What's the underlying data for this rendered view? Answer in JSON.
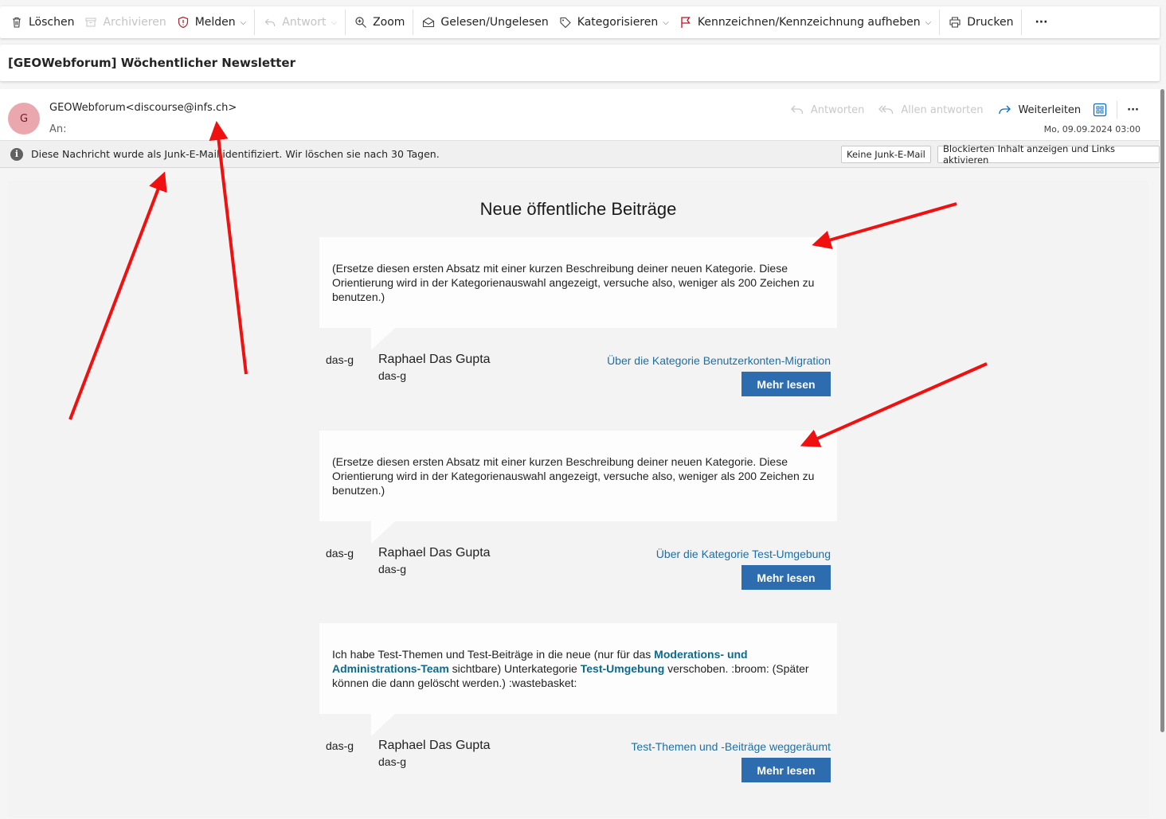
{
  "toolbar": {
    "delete": "Löschen",
    "archive": "Archivieren",
    "report": "Melden",
    "reply": "Antwort",
    "zoom": "Zoom",
    "read_unread": "Gelesen/Ungelesen",
    "categorize": "Kategorisieren",
    "flag": "Kennzeichnen/Kennzeichnung aufheben",
    "print": "Drucken",
    "more": "···"
  },
  "subject": "[GEOWebforum] Wöchentlicher Newsletter",
  "message": {
    "avatar_initial": "G",
    "sender": "GEOWebforum<discourse@infs.ch>",
    "to_label": "An:",
    "actions": {
      "reply": "Antworten",
      "reply_all": "Allen antworten",
      "forward": "Weiterleiten",
      "more": "···"
    },
    "date": "Mo, 09.09.2024 03:00"
  },
  "junk": {
    "notice": "Diese Nachricht wurde als Junk-E-Mail identifiziert. Wir löschen sie nach 30 Tagen.",
    "not_junk_button": "Keine Junk-E-Mail",
    "show_content_button": "Blockierten Inhalt anzeigen und Links aktivieren"
  },
  "newsletter": {
    "title": "Neue öffentliche Beiträge",
    "posts": [
      {
        "text": "(Ersetze diesen ersten Absatz mit einer kurzen Beschreibung deiner neuen Kategorie. Diese Orientierung wird in der Kategorienauswahl angezeigt, versuche also, weniger als 200 Zeichen zu benutzen.)",
        "user_short": "das-g",
        "user_full": "Raphael Das Gupta",
        "user_handle": "das-g",
        "topic": "Über die Kategorie Benutzerkonten-Migration",
        "button": "Mehr lesen"
      },
      {
        "text": "(Ersetze diesen ersten Absatz mit einer kurzen Beschreibung deiner neuen Kategorie. Diese Orientierung wird in der Kategorienauswahl angezeigt, versuche also, weniger als 200 Zeichen zu benutzen.)",
        "user_short": "das-g",
        "user_full": "Raphael Das Gupta",
        "user_handle": "das-g",
        "topic": "Über die Kategorie Test-Umgebung",
        "button": "Mehr lesen"
      },
      {
        "text_parts": {
          "p1": "Ich habe Test-Themen und Test-Beiträge in die neue (nur für das ",
          "link1": "Moderations- und Administrations-Team",
          "p2": " sichtbare) Unterkategorie ",
          "link2": "Test-Umgebung",
          "p3": " verschoben. :broom: (Später können die dann gelöscht werden.) :wastebasket:"
        },
        "user_short": "das-g",
        "user_full": "Raphael Das Gupta",
        "user_handle": "das-g",
        "topic": "Test-Themen und -Beiträge weggeräumt",
        "button": "Mehr lesen"
      }
    ]
  },
  "colors": {
    "annotation_arrow": "#f01010",
    "button_blue": "#2d6daf",
    "link_blue": "#1d6fa5",
    "avatar_bg": "#eaa8ae"
  }
}
